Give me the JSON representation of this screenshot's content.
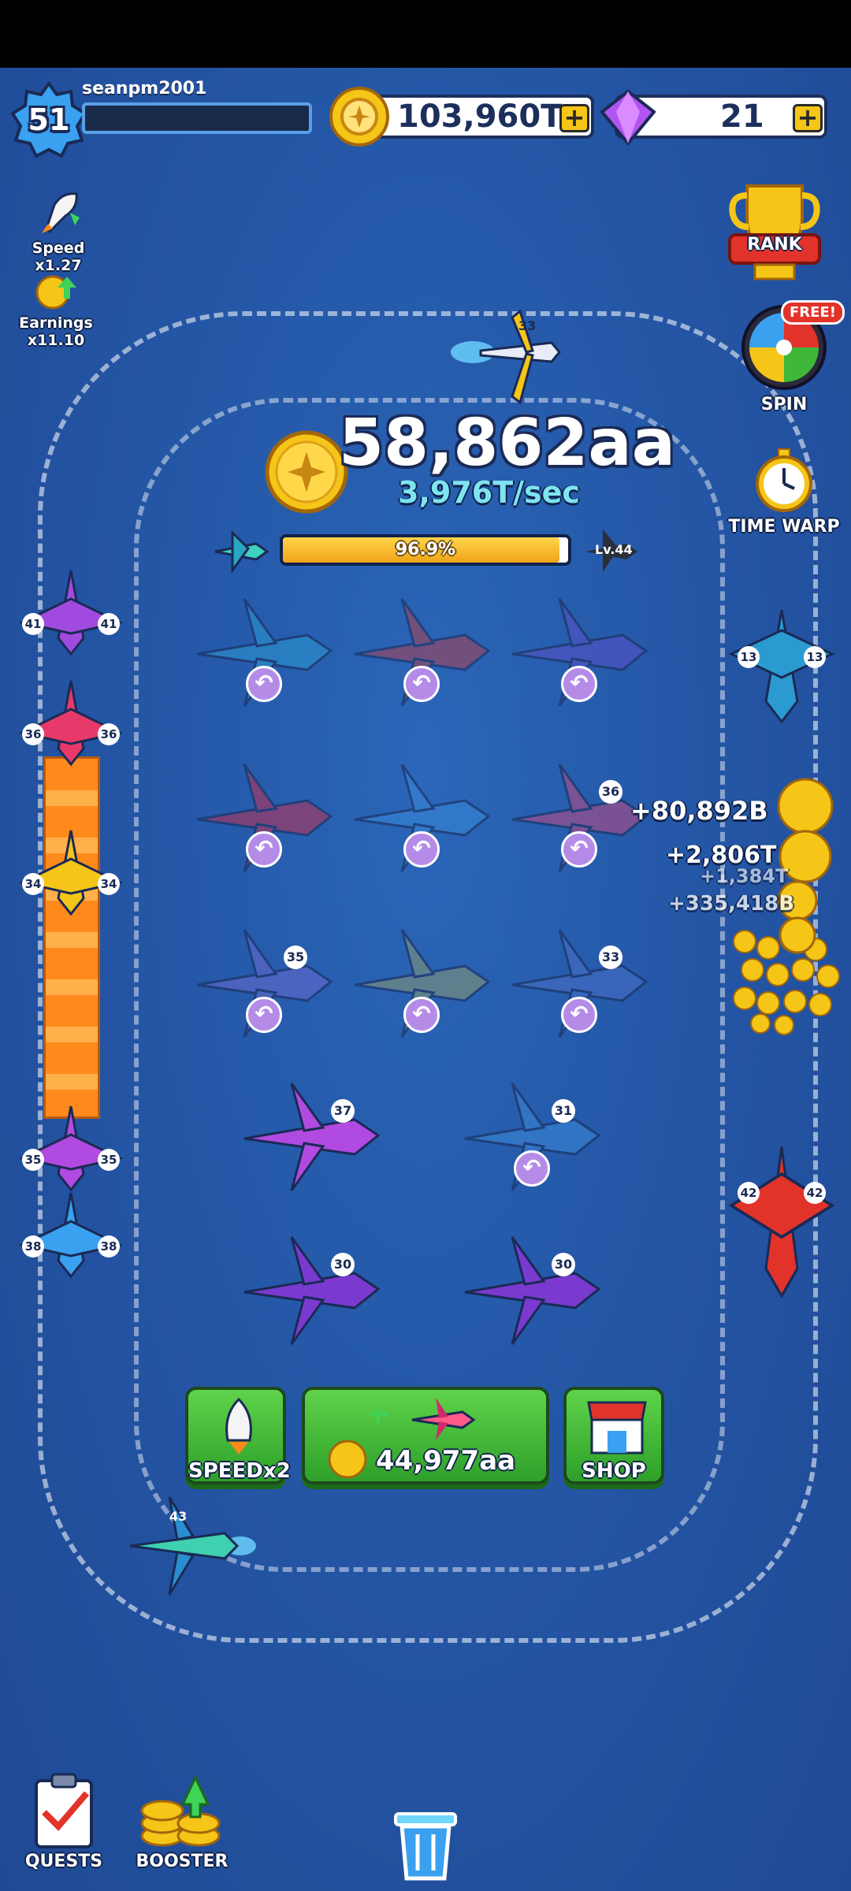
{
  "player": {
    "name": "seanpm2001",
    "level": "51",
    "xp_fraction": 0.0
  },
  "currencies": {
    "coins": "103,960T",
    "gems": "21"
  },
  "boosts": {
    "speed_label": "Speed x1.27",
    "earnings_label": "Earnings x11.10"
  },
  "right_menu": {
    "rank_label": "RANK",
    "free_badge": "FREE!",
    "spin_label": "SPIN",
    "time_warp_label": "TIME WARP"
  },
  "earnings": {
    "total": "58,862aa",
    "rate": "3,976T/sec"
  },
  "progress": {
    "percent_text": "96.9%",
    "fraction": 0.969,
    "next_level": "Lv.44"
  },
  "grid_slots": {
    "r1": [
      "",
      "",
      ""
    ],
    "r2": [
      "",
      "",
      "36"
    ],
    "r3": [
      "35",
      "",
      "33"
    ],
    "r4": [
      "37",
      "31"
    ],
    "r5": [
      "30",
      "30"
    ]
  },
  "runway_planes": [
    "41",
    "36",
    "34",
    "35",
    "38"
  ],
  "right_planes": [
    "13",
    "42"
  ],
  "flying_plane": "33",
  "corner_plane": "43",
  "gains": [
    "+80,892B",
    "+2,806T",
    "+1,384T",
    "+335,418B"
  ],
  "buttons": {
    "speed_label": "SPEEDx2",
    "buy_price": "44,977aa",
    "shop_label": "SHOP"
  },
  "bottom_nav": {
    "quests_label": "QUESTS",
    "booster_label": "BOOSTER"
  },
  "colors": {
    "accent_gold": "#f5c518",
    "bg_blue": "#224f9d",
    "green_button": "#3fb83a"
  }
}
